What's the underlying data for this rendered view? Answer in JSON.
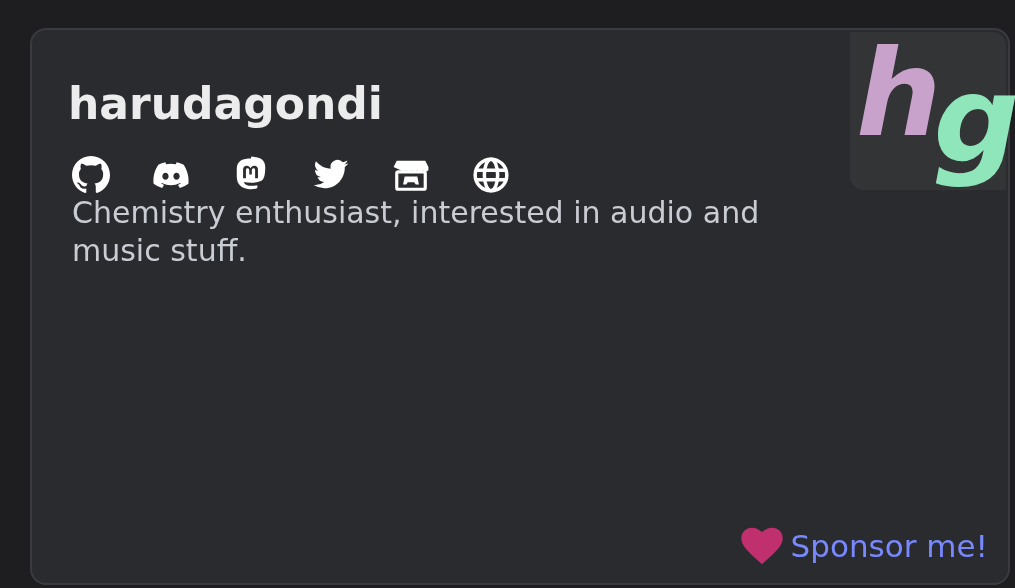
{
  "profile": {
    "name": "harudagondi",
    "bio": "Chemistry enthusiast, interested in audio and music stuff.",
    "sponsor_link": "Sponsor me!"
  },
  "logo": {
    "letters": [
      {
        "text": "h",
        "color": "#c9a2cc"
      },
      {
        "text": "g",
        "color": "#90e6bb"
      }
    ]
  }
}
